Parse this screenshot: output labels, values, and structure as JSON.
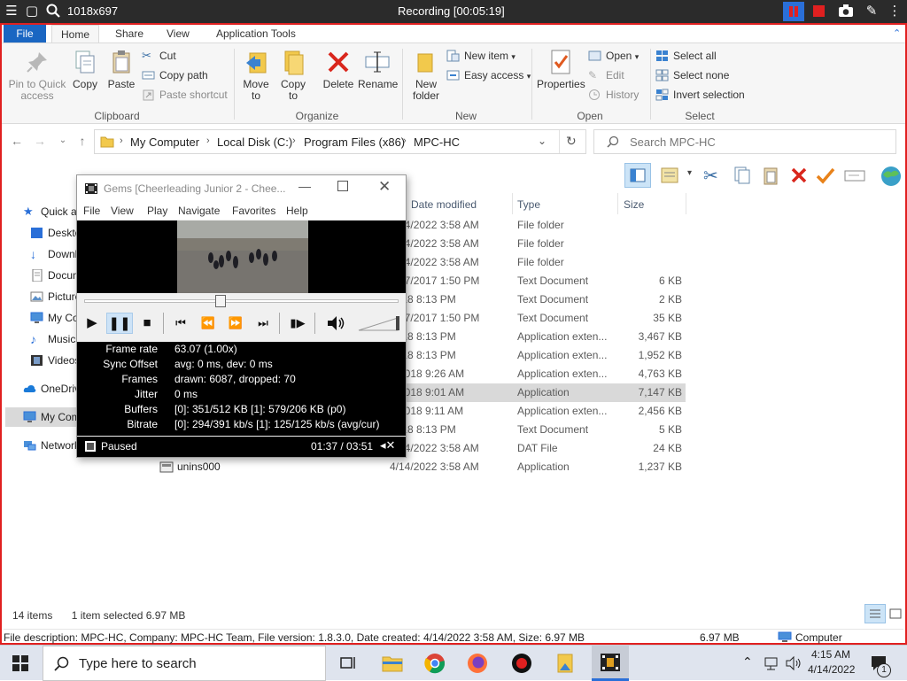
{
  "recbar": {
    "resolution": "1018x697",
    "status": "Recording [00:05:19]"
  },
  "ribbon": {
    "tabs": [
      "File",
      "Home",
      "Share",
      "View",
      "Application Tools"
    ],
    "clipboard": {
      "label": "Clipboard",
      "pin": "Pin to Quick access",
      "copy": "Copy",
      "paste": "Paste",
      "cut": "Cut",
      "copy_path": "Copy path",
      "paste_shortcut": "Paste shortcut"
    },
    "organize": {
      "label": "Organize",
      "move_to": "Move to",
      "copy_to": "Copy to",
      "delete": "Delete",
      "rename": "Rename"
    },
    "new": {
      "label": "New",
      "new_folder": "New folder",
      "new_item": "New item",
      "easy_access": "Easy access"
    },
    "open": {
      "label": "Open",
      "properties": "Properties",
      "open": "Open",
      "edit": "Edit",
      "history": "History"
    },
    "select": {
      "label": "Select",
      "select_all": "Select all",
      "select_none": "Select none",
      "invert": "Invert selection"
    }
  },
  "address": {
    "crumbs": [
      "My Computer",
      "Local Disk (C:)",
      "Program Files (x86)",
      "MPC-HC"
    ],
    "search_placeholder": "Search MPC-HC"
  },
  "navpane": {
    "items": [
      "Quick access",
      "Desktop",
      "Downloads",
      "Documents",
      "Pictures",
      "My Computer",
      "Music",
      "Videos",
      "OneDrive",
      "My Computer",
      "Network"
    ]
  },
  "filelist": {
    "headers": {
      "modified": "Date modified",
      "type": "Type",
      "size": "Size"
    },
    "rows": [
      {
        "date": "4/14/2022 3:58 AM",
        "type": "File folder",
        "size": ""
      },
      {
        "date": "4/14/2022 3:58 AM",
        "type": "File folder",
        "size": ""
      },
      {
        "date": "4/14/2022 3:58 AM",
        "type": "File folder",
        "size": ""
      },
      {
        "date": "7/17/2017 1:50 PM",
        "type": "Text Document",
        "size": "6 KB"
      },
      {
        "date": "2018 8:13 PM",
        "type": "Text Document",
        "size": "2 KB"
      },
      {
        "date": "7/17/2017 1:50 PM",
        "type": "Text Document",
        "size": "35 KB"
      },
      {
        "date": "2018 8:13 PM",
        "type": "Application exten...",
        "size": "3,467 KB"
      },
      {
        "date": "2018 8:13 PM",
        "type": "Application exten...",
        "size": "1,952 KB"
      },
      {
        "date": "0/2018 9:26 AM",
        "type": "Application exten...",
        "size": "4,763 KB"
      },
      {
        "date": "6/2018 9:01 AM",
        "type": "Application",
        "size": "7,147 KB"
      },
      {
        "date": "6/2018 9:11 AM",
        "type": "Application exten...",
        "size": "2,456 KB"
      },
      {
        "date": "2018 8:13 PM",
        "type": "Text Document",
        "size": "5 KB"
      },
      {
        "date": "4/14/2022 3:58 AM",
        "type": "DAT File",
        "size": "24 KB"
      },
      {
        "name": "unins000",
        "date": "4/14/2022 3:58 AM",
        "type": "Application",
        "size": "1,237 KB"
      }
    ]
  },
  "status": {
    "items": "14 items",
    "selected": "1 item selected  6.97 MB",
    "description": "File description: MPC-HC, Company: MPC-HC Team, File version: 1.8.3.0, Date created: 4/14/2022 3:58 AM, Size: 6.97 MB",
    "size": "6.97 MB",
    "location": "Computer"
  },
  "mpc": {
    "title": "Gems  [Cheerleading Junior 2 - Chee...",
    "menu": [
      "File",
      "View",
      "Play",
      "Navigate",
      "Favorites",
      "Help"
    ],
    "seek_position": 0.43,
    "volume_level": 1.0,
    "stats": [
      {
        "k": "Frame rate",
        "v": "63.07 (1.00x)"
      },
      {
        "k": "Sync Offset",
        "v": "avg: 0 ms, dev: 0 ms"
      },
      {
        "k": "Frames",
        "v": "drawn: 6087, dropped: 70"
      },
      {
        "k": "Jitter",
        "v": "0 ms"
      },
      {
        "k": "Buffers",
        "v": "[0]: 351/512 KB [1]: 579/206 KB (p0)"
      },
      {
        "k": "Bitrate",
        "v": "[0]: 294/391 kb/s [1]: 125/125 kb/s (avg/cur)"
      }
    ],
    "state": "Paused",
    "time": "01:37 / 03:51"
  },
  "taskbar": {
    "search_placeholder": "Type here to search",
    "time": "4:15 AM",
    "date": "4/14/2022",
    "notif_count": "1"
  }
}
